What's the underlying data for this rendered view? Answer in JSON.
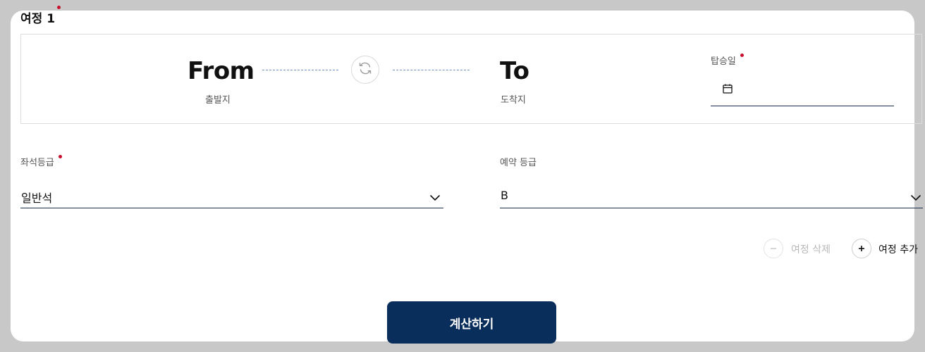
{
  "journey": {
    "title": "여정 1",
    "from_label": "From",
    "from_sub": "출발지",
    "to_label": "To",
    "to_sub": "도착지",
    "date_label": "탑승일",
    "date_value": ""
  },
  "seat_class": {
    "label": "좌석등급",
    "value": "일반석"
  },
  "booking_class": {
    "label": "예약 등급",
    "value": "B"
  },
  "actions": {
    "delete_label": "여정 삭제",
    "add_label": "여정 추가",
    "calculate_label": "계산하기"
  },
  "colors": {
    "required_dot": "#c8102e",
    "primary_button": "#0a2e5c",
    "underline": "#1a2a4a",
    "dash": "#6d8fbf"
  },
  "icons": {
    "swap": "swap-icon",
    "calendar": "calendar-icon",
    "chevron": "chevron-down-icon",
    "minus": "minus-icon",
    "plus": "plus-icon"
  }
}
